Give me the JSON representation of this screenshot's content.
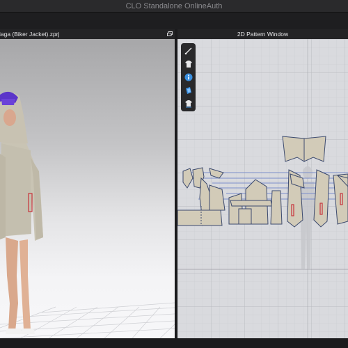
{
  "window": {
    "title": "CLO Standalone OnlineAuth"
  },
  "left_panel": {
    "file_name": "iaga (Biker Jacket).zprj",
    "restore_icon": "restore-window-icon"
  },
  "right_panel": {
    "title": "2D Pattern Window"
  },
  "palette": {
    "tools": [
      {
        "name": "pen-tool-icon"
      },
      {
        "name": "garment-icon"
      },
      {
        "name": "info-icon"
      },
      {
        "name": "fabric-icon"
      },
      {
        "name": "garment-list-icon"
      }
    ]
  },
  "colors": {
    "pattern_fill": "#d2cbb8",
    "pattern_stroke": "#3c4a6e",
    "seam_line": "#7b8dc9",
    "accent_red": "#c8323a",
    "tool_blue": "#3a8fe0"
  }
}
